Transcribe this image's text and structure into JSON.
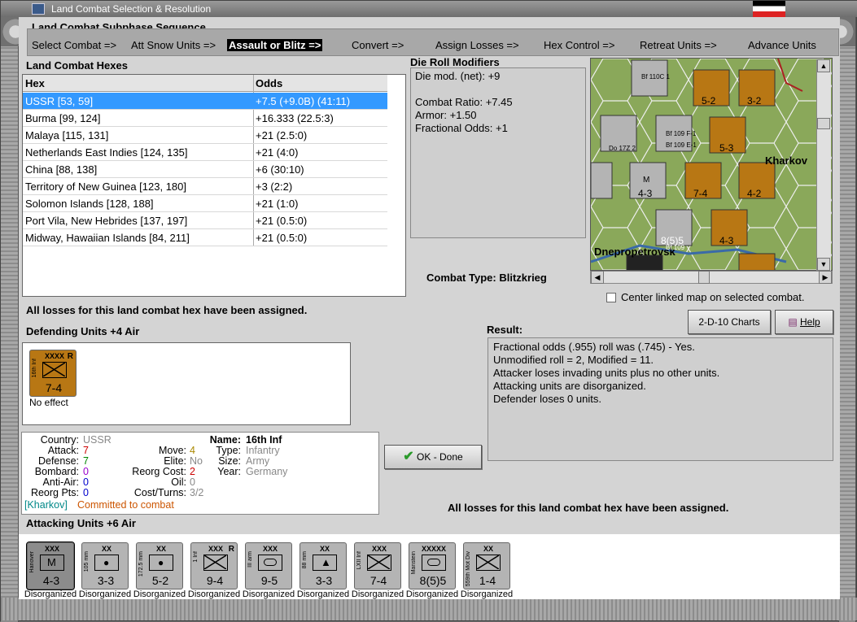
{
  "window": {
    "title": "Land Combat Selection & Resolution"
  },
  "subphase": {
    "heading": "Land Combat Subphase Sequence",
    "steps": [
      "Select Combat =>",
      "Att Snow Units =>",
      "Assault or Blitz =>",
      "Convert =>",
      "Assign Losses =>",
      "Hex Control =>",
      "Retreat Units =>",
      "Advance Units"
    ],
    "active_index": 2
  },
  "hexes": {
    "heading": "Land Combat Hexes",
    "col_hex": "Hex",
    "col_odds": "Odds",
    "rows": [
      {
        "hex": "USSR [53, 59]",
        "odds": "+7.5 (+9.0B) (41:11)"
      },
      {
        "hex": "Burma [99, 124]",
        "odds": "+16.333 (22.5:3)"
      },
      {
        "hex": "Malaya [115, 131]",
        "odds": "+21 (2.5:0)"
      },
      {
        "hex": "Netherlands East Indies [124, 135]",
        "odds": "+21 (4:0)"
      },
      {
        "hex": "China [88, 138]",
        "odds": "+6 (30:10)"
      },
      {
        "hex": "Territory of New Guinea [123, 180]",
        "odds": "+3 (2:2)"
      },
      {
        "hex": "Solomon Islands [128, 188]",
        "odds": "+21 (1:0)"
      },
      {
        "hex": "Port Vila, New Hebrides [137, 197]",
        "odds": "+21 (0.5:0)"
      },
      {
        "hex": "Midway, Hawaiian Islands [84, 211]",
        "odds": "+21 (0.5:0)"
      }
    ]
  },
  "die": {
    "heading": "Die Roll Modifiers",
    "lines": [
      "Die mod. (net): +9",
      "",
      "Combat Ratio: +7.45",
      "Armor: +1.50",
      "Fractional Odds: +1"
    ]
  },
  "map": {
    "labels": [
      "Kharkov",
      "Dnepropetrovsk"
    ],
    "counters": [
      "Bf 110C 1",
      "Do 17Z 2",
      "Bf 109 F-1",
      "Bf 109 E-1",
      "Bf 109",
      "5-2",
      "3-2",
      "5-3",
      "7-4",
      "4-2",
      "4-3",
      "4-3",
      "8(5)5",
      "M"
    ]
  },
  "combat_type": {
    "label": "Combat Type:",
    "value": "Blitzkrieg"
  },
  "center_map": {
    "label": "Center linked map on selected combat."
  },
  "losses_msg": "All losses for this land combat hex have been assigned.",
  "buttons": {
    "charts": "2-D-10 Charts",
    "help": "Help",
    "ok": "OK - Done"
  },
  "defending": {
    "heading": "Defending Units +4 Air",
    "units": [
      {
        "name": "16th Inf",
        "size": "XXXX",
        "flag": "R",
        "strength": "7-4",
        "status": "No effect"
      }
    ]
  },
  "info": {
    "country_k": "Country:",
    "country_v": "USSR",
    "attack_k": "Attack:",
    "attack_v": "7",
    "defense_k": "Defense:",
    "defense_v": "7",
    "bombard_k": "Bombard:",
    "bombard_v": "0",
    "antiair_k": "Anti-Air:",
    "antiair_v": "0",
    "reorg_k": "Reorg Pts:",
    "reorg_v": "0",
    "move_k": "Move:",
    "move_v": "4",
    "elite_k": "Elite:",
    "elite_v": "No",
    "reorgcost_k": "Reorg Cost:",
    "reorgcost_v": "2",
    "oil_k": "Oil:",
    "oil_v": "0",
    "cost_k": "Cost/Turns:",
    "cost_v": "3/2",
    "name_k": "Name:",
    "name_v": "16th Inf",
    "type_k": "Type:",
    "type_v": "Infantry",
    "size_k": "Size:",
    "size_v": "Army",
    "year_k": "Year:",
    "year_v": "Germany",
    "location": "[Kharkov]",
    "committed": "Committed to combat"
  },
  "result": {
    "heading": "Result:",
    "lines": [
      "Fractional odds (.955) roll was (.745)  - Yes.",
      "Unmodified roll = 2, Modified = 11.",
      "Attacker loses invading units plus no other units.",
      "Attacking units are disorganized.",
      "Defender loses 0 units."
    ]
  },
  "attacking": {
    "heading": "Attacking Units +6 Air",
    "units": [
      {
        "name": "Hanover",
        "size": "XXX",
        "sym": "M",
        "strength": "4-3",
        "status": "Disorganized",
        "color": "#8c8c8c"
      },
      {
        "name": "105 mm",
        "size": "XX",
        "sym": "dot",
        "strength": "3-3",
        "status": "Disorganized",
        "color": "#b4b4b4"
      },
      {
        "name": "172.5 mm",
        "size": "XX",
        "sym": "dot",
        "strength": "5-2",
        "status": "Disorganized",
        "color": "#b4b4b4"
      },
      {
        "name": "1 Inf",
        "size": "XXX",
        "flag": "R",
        "sym": "x",
        "strength": "9-4",
        "status": "Disorganized",
        "color": "#b4b4b4"
      },
      {
        "name": "III arm",
        "size": "XXX",
        "sym": "o",
        "strength": "9-5",
        "status": "Disorganized",
        "color": "#b4b4b4"
      },
      {
        "name": "88 mm",
        "size": "XX",
        "sym": "tri",
        "strength": "3-3",
        "status": "Disorganized",
        "color": "#b4b4b4"
      },
      {
        "name": "LXII Inf",
        "size": "XXX",
        "sym": "x",
        "strength": "7-4",
        "status": "Disorganized",
        "color": "#b4b4b4"
      },
      {
        "name": "Manstein",
        "size": "XXXXX",
        "sym": "o",
        "strength": "8(5)5",
        "status": "Disorganized",
        "color": "#b4b4b4"
      },
      {
        "name": "559th Mot Div",
        "size": "XX",
        "sym": "x",
        "strength": "1-4",
        "status": "Disorganized",
        "color": "#b4b4b4"
      }
    ]
  },
  "colors": {
    "selected_row": "#3399ff",
    "attack_red": "#cc0000",
    "defense_green": "#008800",
    "bombard_purple": "#9900cc",
    "antiair_blue": "#0000cc",
    "move_orange": "#aa8800",
    "committed": "#cc5500",
    "location_teal": "#008888"
  }
}
